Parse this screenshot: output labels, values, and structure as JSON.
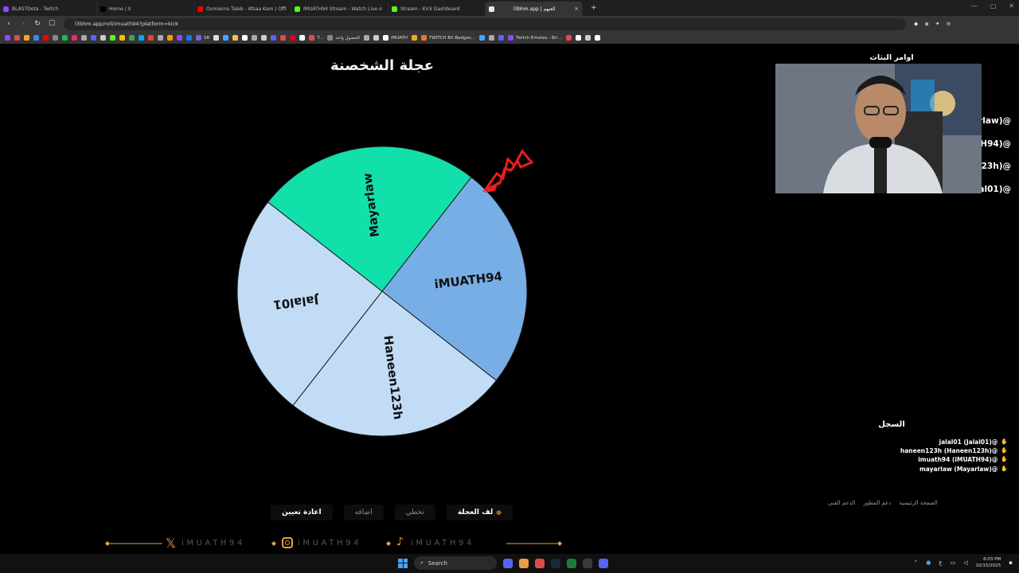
{
  "browser": {
    "tabs": [
      {
        "label": "BLASTDota - Twitch",
        "color": "#9146ff"
      },
      {
        "label": "Home / X",
        "color": "#000000"
      },
      {
        "label": "Oumaima Taleb - Afsaa Kam | Offi",
        "color": "#ff0000"
      },
      {
        "label": "IMUATH94 Stream - Watch Live o",
        "color": "#53fc18"
      },
      {
        "label": "Stream - Kick Dashboard",
        "color": "#53fc18"
      },
      {
        "label": "l3bhm.app | العبهم",
        "color": "#e8e8e8",
        "active": true
      }
    ],
    "url": "l3bhm.app/roll/imuath94?platform=kick",
    "bookmarks": [
      {
        "label": "",
        "color": "#9146ff"
      },
      {
        "label": "",
        "color": "#e24a4a"
      },
      {
        "label": "",
        "color": "#f5a623"
      },
      {
        "label": "",
        "color": "#4285f4"
      },
      {
        "label": "",
        "color": "#ff0000"
      },
      {
        "label": "",
        "color": "#888888"
      },
      {
        "label": "",
        "color": "#1db954"
      },
      {
        "label": "",
        "color": "#e1306c"
      },
      {
        "label": "",
        "color": "#aaaaaa"
      },
      {
        "label": "",
        "color": "#5865f2"
      },
      {
        "label": "",
        "color": "#cccccc"
      },
      {
        "label": "",
        "color": "#53fc18"
      },
      {
        "label": "",
        "color": "#fbbc04"
      },
      {
        "label": "",
        "color": "#34a853"
      },
      {
        "label": "",
        "color": "#00acee"
      },
      {
        "label": "",
        "color": "#ea4335"
      },
      {
        "label": "",
        "color": "#aaaaaa"
      },
      {
        "label": "",
        "color": "#ff9900"
      },
      {
        "label": "",
        "color": "#9146ff"
      },
      {
        "label": "",
        "color": "#1877f2"
      },
      {
        "label": "SR",
        "color": "#6b6bd6"
      },
      {
        "label": "",
        "color": "#dddddd"
      },
      {
        "label": "",
        "color": "#4aa3ff"
      },
      {
        "label": "",
        "color": "#f5c04a"
      },
      {
        "label": "",
        "color": "#ffffff"
      },
      {
        "label": "",
        "color": "#aaaaaa"
      },
      {
        "label": "",
        "color": "#cccccc"
      },
      {
        "label": "",
        "color": "#5865f2"
      },
      {
        "label": "",
        "color": "#e24a4a"
      },
      {
        "label": "",
        "color": "#e60023"
      },
      {
        "label": "",
        "color": "#ffffff"
      },
      {
        "label": "T...",
        "color": "#e24a4a"
      },
      {
        "label": "الحصول واحد",
        "color": "#888888"
      },
      {
        "label": "",
        "color": "#aaaaaa"
      },
      {
        "label": "",
        "color": "#cccccc"
      },
      {
        "label": "iMUATH",
        "color": "#ffffff"
      },
      {
        "label": "",
        "color": "#f5a623"
      },
      {
        "label": "TWITCH Bit Badges...",
        "color": "#e8772e"
      },
      {
        "label": "",
        "color": "#4aa3ff"
      },
      {
        "label": "",
        "color": "#aaaaaa"
      },
      {
        "label": "",
        "color": "#5865f2"
      },
      {
        "label": "Twitch Emotes - Bri...",
        "color": "#9146ff"
      },
      {
        "label": "",
        "color": "#e24a4a"
      },
      {
        "label": "",
        "color": "#ffffff"
      },
      {
        "label": "",
        "color": "#cccccc"
      },
      {
        "label": "",
        "color": "#ffffff"
      }
    ]
  },
  "page": {
    "title": "عجلة الشخصنة"
  },
  "wheel": {
    "segments": [
      {
        "name": "iMUATH94",
        "color": "#78aee6"
      },
      {
        "name": "Haneen123h",
        "color": "#c2dcf6"
      },
      {
        "name": "Jalal01",
        "color": "#c2dcf6"
      },
      {
        "name": "Mayarlaw",
        "color": "#12e0aa"
      }
    ],
    "pointer_color": "#e81e1e"
  },
  "commands": {
    "title": "اوامر البثاث",
    "items": [
      "rlaw)@",
      "H94)@",
      "123h)@",
      "lal01)@"
    ]
  },
  "log": {
    "title": "السجل",
    "entries": [
      "jalal01 (Jalal01)@",
      "haneen123h (Haneen123h)@",
      "imuath94 (iMUATH94)@",
      "mayarlaw (Mayarlaw)@"
    ]
  },
  "footer_links": [
    "الدعم الفني",
    "دعم المطور",
    "الصفحة الرئيسية"
  ],
  "controls": {
    "spin": "لف العجلة",
    "skip": "تخطي",
    "add": "اضافه",
    "reset": "اعادة تعيين"
  },
  "social": {
    "handle": "iMUATH94",
    "accent": "#e8a040"
  },
  "taskbar": {
    "search_placeholder": "Search",
    "lang": "ع",
    "time": "6:03 PM",
    "date": "10/15/2025"
  }
}
